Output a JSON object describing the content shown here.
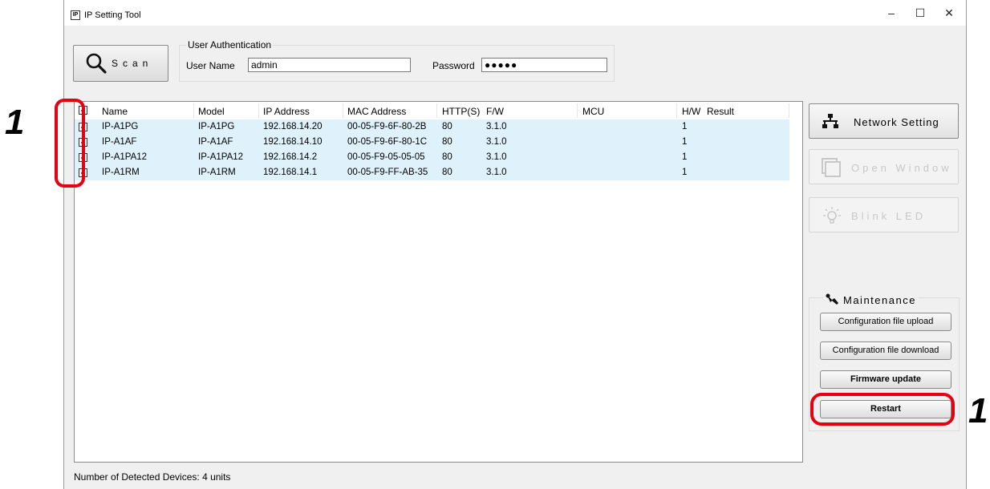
{
  "window": {
    "title": "IP Setting Tool",
    "app_icon_text": "IP",
    "minimize": "–",
    "maximize": "☐",
    "close": "✕"
  },
  "toolbar": {
    "scan_label": "Scan",
    "auth_group_label": "User Authentication",
    "username_label": "User Name",
    "username_value": "admin",
    "password_label": "Password",
    "password_value": "●●●●●"
  },
  "table": {
    "headers": {
      "name": "Name",
      "model": "Model",
      "ip": "IP Address",
      "mac": "MAC Address",
      "http": "HTTP(S)",
      "fw": "F/W",
      "mcu": "MCU",
      "hw": "H/W",
      "result": "Result"
    },
    "header_checked": true,
    "rows": [
      {
        "checked": true,
        "name": "IP-A1PG",
        "model": "IP-A1PG",
        "ip": "192.168.14.20",
        "mac": "00-05-F9-6F-80-2B",
        "http": "80",
        "fw": "3.1.0",
        "mcu": "",
        "hw": "1",
        "result": ""
      },
      {
        "checked": true,
        "name": "IP-A1AF",
        "model": "IP-A1AF",
        "ip": "192.168.14.10",
        "mac": "00-05-F9-6F-80-1C",
        "http": "80",
        "fw": "3.1.0",
        "mcu": "",
        "hw": "1",
        "result": ""
      },
      {
        "checked": true,
        "name": "IP-A1PA12",
        "model": "IP-A1PA12",
        "ip": "192.168.14.2",
        "mac": "00-05-F9-05-05-05",
        "http": "80",
        "fw": "3.1.0",
        "mcu": "",
        "hw": "1",
        "result": ""
      },
      {
        "checked": true,
        "name": "IP-A1RM",
        "model": "IP-A1RM",
        "ip": "192.168.14.1",
        "mac": "00-05-F9-FF-AB-35",
        "http": "80",
        "fw": "3.1.0",
        "mcu": "",
        "hw": "1",
        "result": ""
      }
    ]
  },
  "side": {
    "network_setting": "Network Setting",
    "open_window": "Open Window",
    "blink_led": "Blink LED"
  },
  "maintenance": {
    "label": "Maintenance",
    "config_upload": "Configuration file upload",
    "config_download": "Configuration file download",
    "firmware_update": "Firmware update",
    "restart": "Restart"
  },
  "status": {
    "detected": "Number of Detected Devices: 4 units"
  },
  "annotations": {
    "callout_left": "1",
    "callout_right": "1",
    "highlight_color": "#e60012"
  },
  "icons": {
    "scan": "magnifier-icon",
    "network": "network-icon",
    "open_window": "window-icon",
    "blink_led": "bulb-icon",
    "maintenance": "wrench-icon"
  }
}
